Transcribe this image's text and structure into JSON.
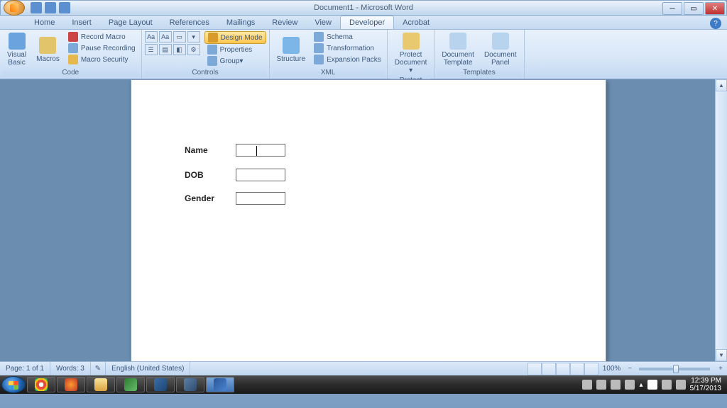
{
  "window": {
    "title": "Document1 - Microsoft Word"
  },
  "tabs": {
    "home": "Home",
    "insert": "Insert",
    "page_layout": "Page Layout",
    "references": "References",
    "mailings": "Mailings",
    "review": "Review",
    "view": "View",
    "developer": "Developer",
    "acrobat": "Acrobat"
  },
  "ribbon": {
    "code": {
      "label": "Code",
      "visual_basic": "Visual\nBasic",
      "macros": "Macros",
      "record_macro": "Record Macro",
      "pause_recording": "Pause Recording",
      "macro_security": "Macro Security"
    },
    "controls": {
      "label": "Controls",
      "design_mode": "Design Mode",
      "properties": "Properties",
      "group": "Group"
    },
    "xml": {
      "label": "XML",
      "structure": "Structure",
      "schema": "Schema",
      "transformation": "Transformation",
      "expansion_packs": "Expansion Packs"
    },
    "protect": {
      "label": "Protect",
      "protect_document": "Protect\nDocument"
    },
    "templates": {
      "label": "Templates",
      "document_template": "Document\nTemplate",
      "document_panel": "Document\nPanel"
    }
  },
  "document": {
    "fields": {
      "name": "Name",
      "dob": "DOB",
      "gender": "Gender"
    }
  },
  "statusbar": {
    "page": "Page: 1 of 1",
    "words": "Words: 3",
    "language": "English (United States)",
    "zoom": "100%"
  },
  "system": {
    "time": "12:39 PM",
    "date": "5/17/2013"
  }
}
